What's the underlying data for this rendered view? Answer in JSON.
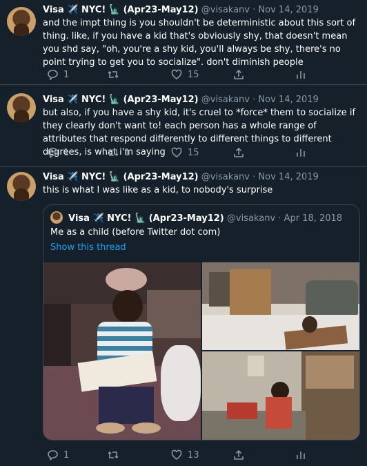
{
  "tweets": [
    {
      "name": "Visa ✈️ NYC! 🗽 (Apr23-May12)",
      "handle": "@visakanv",
      "date": "Nov 14, 2019",
      "text": "and the impt thing is you shouldn't be deterministic about this sort of thing. like, if you have a kid that's obviously shy, that doesn't mean you shd say, \"oh, you're a shy kid, you'll always be shy, there's no point trying to get you to socialize\". don't diminish people",
      "reply_count": "1",
      "retweet_count": "",
      "like_count": "15"
    },
    {
      "name": "Visa ✈️ NYC! 🗽 (Apr23-May12)",
      "handle": "@visakanv",
      "date": "Nov 14, 2019",
      "text": "but also, if you have a shy kid, it's cruel to *force* them to socialize if they clearly don't want to! each person has a whole range of attributes that respond differently to different things to different degrees, is what i'm saying",
      "reply_count": "1",
      "retweet_count": "1",
      "like_count": "15"
    },
    {
      "name": "Visa ✈️ NYC! 🗽 (Apr23-May12)",
      "handle": "@visakanv",
      "date": "Nov 14, 2019",
      "text": "this is what I was like as a kid, to nobody's surprise",
      "reply_count": "1",
      "retweet_count": "",
      "like_count": "13"
    }
  ],
  "quoted": {
    "name": "Visa ✈️ NYC! 🗽 (Apr23-May12)",
    "handle": "@visakanv",
    "date": "Apr 18, 2018",
    "text": "Me as a child (before Twitter dot com)",
    "thread_link": "Show this thread"
  },
  "separator": "·",
  "colors": {
    "background": "#15202b",
    "secondary_text": "#8899a6",
    "link": "#1da1f2",
    "border": "#38444d"
  },
  "icons": [
    "reply-icon",
    "retweet-icon",
    "like-icon",
    "share-icon",
    "analytics-icon"
  ]
}
